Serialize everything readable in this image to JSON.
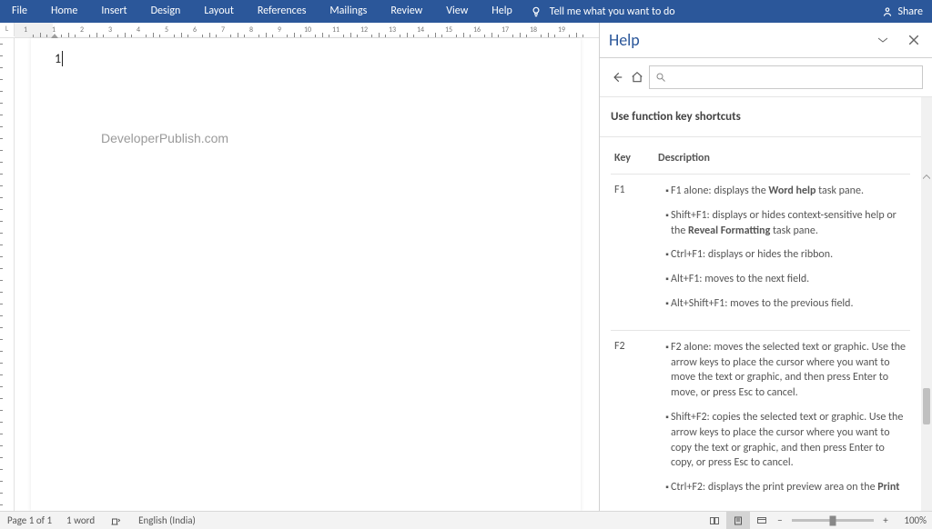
{
  "ribbon": {
    "tabs": [
      "File",
      "Home",
      "Insert",
      "Design",
      "Layout",
      "References",
      "Mailings",
      "Review",
      "View",
      "Help"
    ],
    "tell_me": "Tell me what you want to do",
    "share": "Share"
  },
  "document": {
    "text": "1",
    "watermark": "DeveloperPublish.com"
  },
  "help": {
    "title": "Help",
    "article_title": "Use function key shortcuts",
    "columns": {
      "key": "Key",
      "desc": "Description"
    },
    "rows": [
      {
        "key": "F1",
        "items": [
          {
            "pre": "F1 alone: displays the ",
            "bold": "Word help",
            "post": " task pane."
          },
          {
            "pre": "Shift+F1: displays or hides context-sensitive help or the ",
            "bold": "Reveal Formatting",
            "post": " task pane."
          },
          {
            "pre": "Ctrl+F1: displays or hides the ribbon.",
            "bold": "",
            "post": ""
          },
          {
            "pre": "Alt+F1: moves to the next field.",
            "bold": "",
            "post": ""
          },
          {
            "pre": "Alt+Shift+F1: moves to the previous field.",
            "bold": "",
            "post": ""
          }
        ]
      },
      {
        "key": "F2",
        "items": [
          {
            "pre": "F2 alone: moves the selected text or graphic. Use the arrow keys to place the cursor where you want to move the text or graphic, and then press Enter to move, or press Esc to cancel.",
            "bold": "",
            "post": ""
          },
          {
            "pre": "Shift+F2: copies the selected text or graphic. Use the arrow keys to place the cursor where you want to copy the text or graphic, and then press Enter to copy, or press Esc to cancel.",
            "bold": "",
            "post": ""
          },
          {
            "pre": "Ctrl+F2: displays the print preview area on the ",
            "bold": "Print",
            "post": ""
          }
        ]
      }
    ]
  },
  "status": {
    "page": "Page 1 of 1",
    "words": "1 word",
    "lang": "English (India)",
    "zoom": "100%"
  },
  "ruler": {
    "h_numbers": [
      1,
      1,
      2,
      3,
      4,
      5,
      6,
      7,
      8,
      9,
      10,
      11,
      12,
      13,
      14,
      15,
      16,
      17,
      18,
      19
    ]
  }
}
